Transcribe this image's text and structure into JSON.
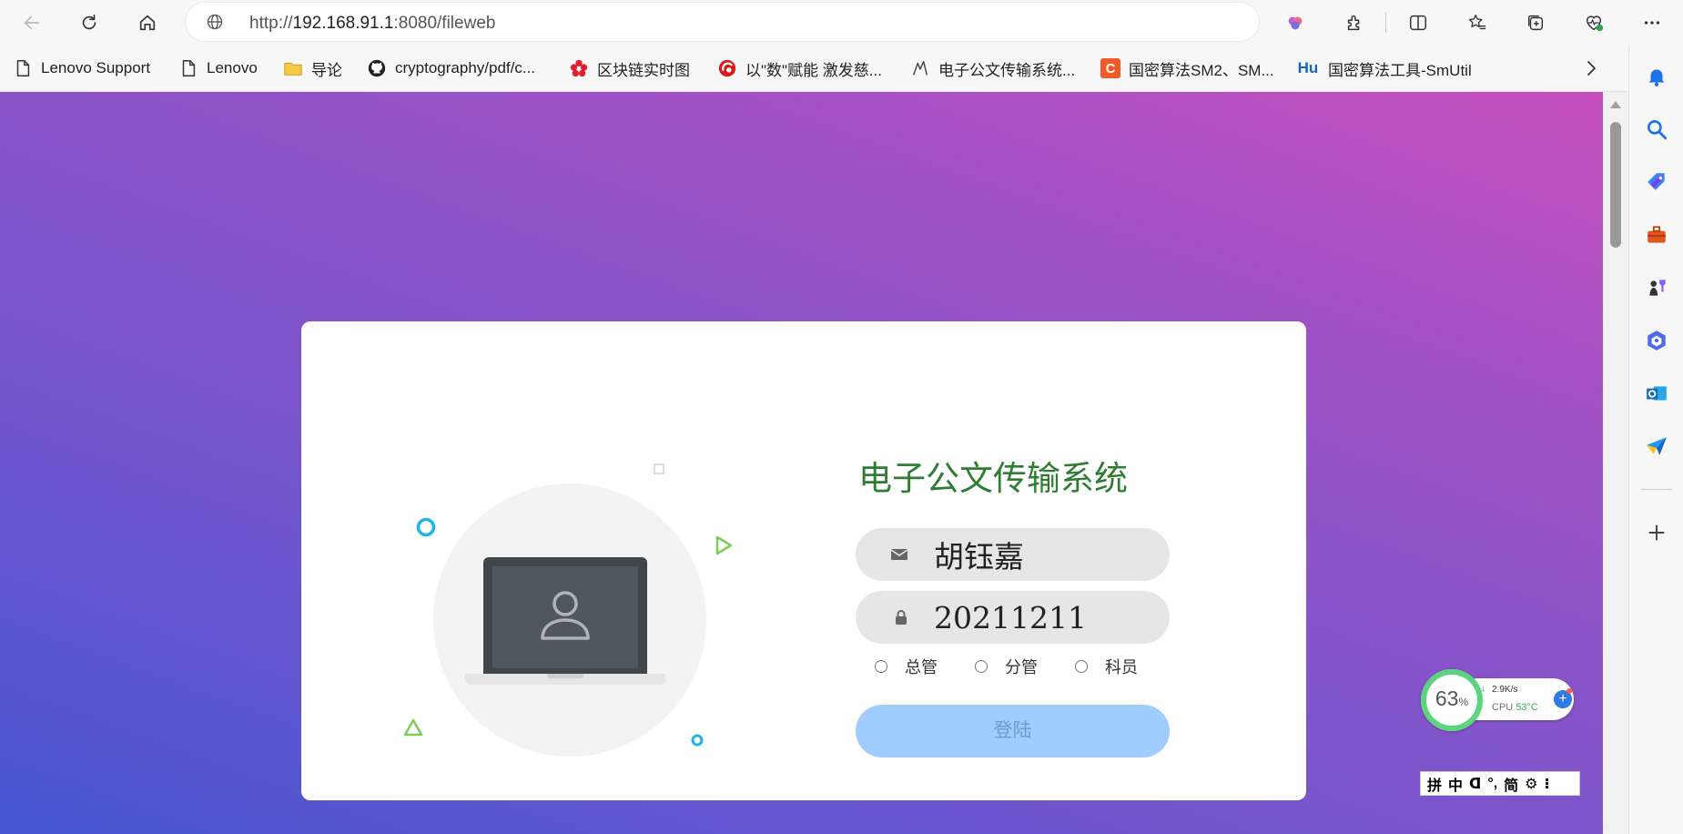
{
  "browser": {
    "url_prefix": "http://",
    "url_host": "192.168.91.1",
    "url_rest": ":8080/fileweb"
  },
  "bookmarks": [
    {
      "label": "Lenovo Support",
      "icon": "page-icon"
    },
    {
      "label": "Lenovo",
      "icon": "page-icon"
    },
    {
      "label": "导论",
      "icon": "folder-icon"
    },
    {
      "label": "cryptography/pdf/c...",
      "icon": "github-icon"
    },
    {
      "label": "区块链实时图",
      "icon": "flower-icon"
    },
    {
      "label": "以\"数\"赋能 激发慈...",
      "icon": "red-swirl-icon"
    },
    {
      "label": "电子公文传输系统...",
      "icon": "bird-icon"
    },
    {
      "label": "国密算法SM2、SM...",
      "icon": "c-logo-icon"
    },
    {
      "label": "国密算法工具-SmUtil",
      "icon": "hu-logo-icon"
    }
  ],
  "hu_logo_text": "Hu",
  "c_logo_text": "C",
  "login": {
    "title": "电子公文传输系统",
    "username_value": "胡钰嘉",
    "password_value": "20211211",
    "roles": [
      "总管",
      "分管",
      "科员"
    ],
    "button_label": "登陆"
  },
  "monitor": {
    "percent": "63",
    "percent_unit": "%",
    "net_speed": "2.9K/s",
    "cpu_label": "CPU",
    "cpu_temp": "53°C"
  },
  "ime": {
    "items": [
      "拼",
      "中",
      "ᗡ",
      "°,",
      "简",
      "⚙",
      "⁝"
    ]
  },
  "colors": {
    "title": "#2e7d32",
    "button": "#9fcdfd",
    "gradient_top_right": "#c64fbf",
    "gradient_bottom_left": "#4656d2"
  }
}
